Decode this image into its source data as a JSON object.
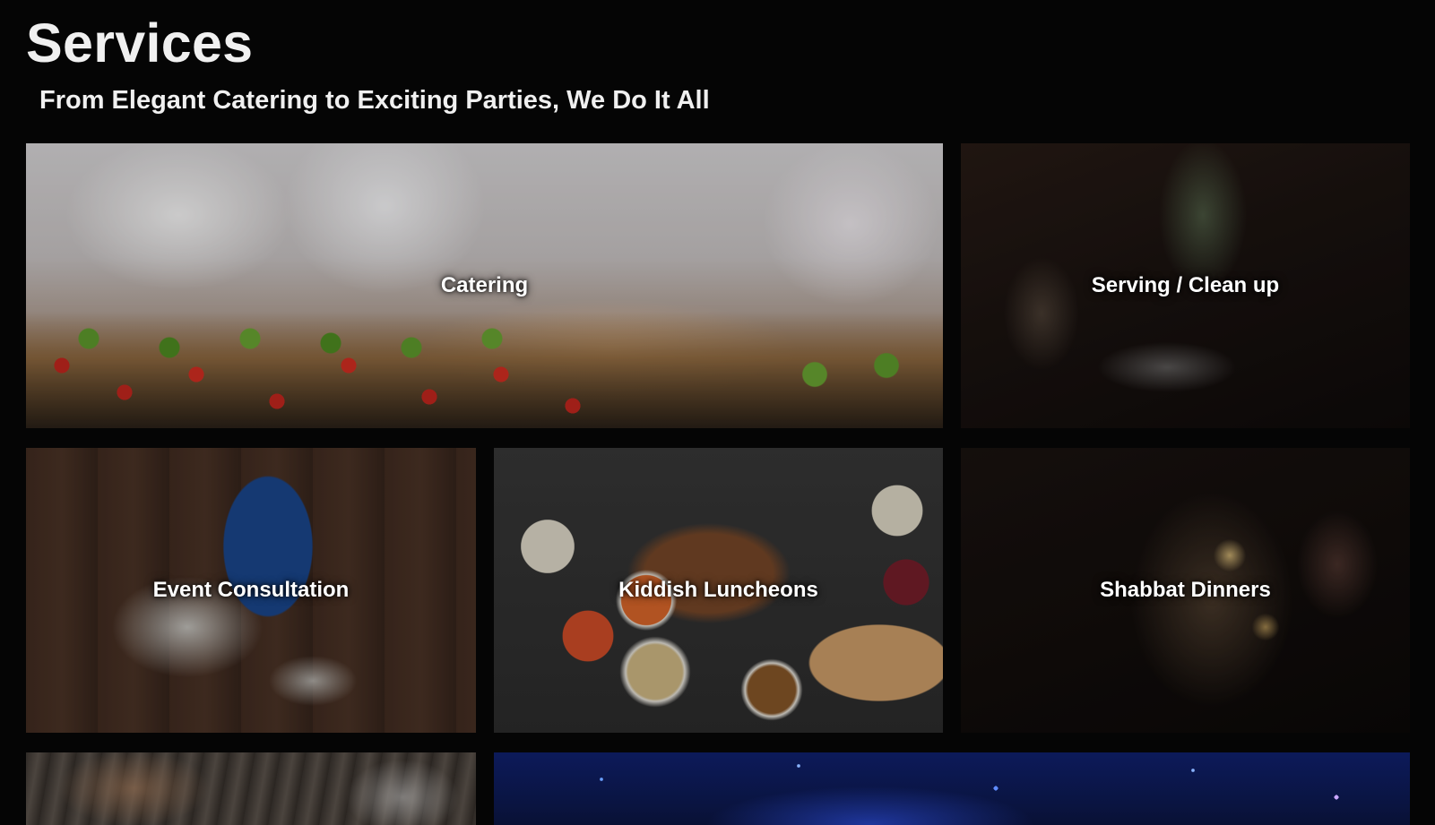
{
  "header": {
    "title": "Services",
    "subtitle": "From Elegant Catering to Exciting Parties, We Do It All"
  },
  "services": [
    {
      "label": "Catering"
    },
    {
      "label": "Serving / Clean up"
    },
    {
      "label": "Event Consultation"
    },
    {
      "label": "Kiddish Luncheons"
    },
    {
      "label": "Shabbat Dinners"
    }
  ],
  "colors": {
    "background": "#050505",
    "text": "#ffffff"
  }
}
